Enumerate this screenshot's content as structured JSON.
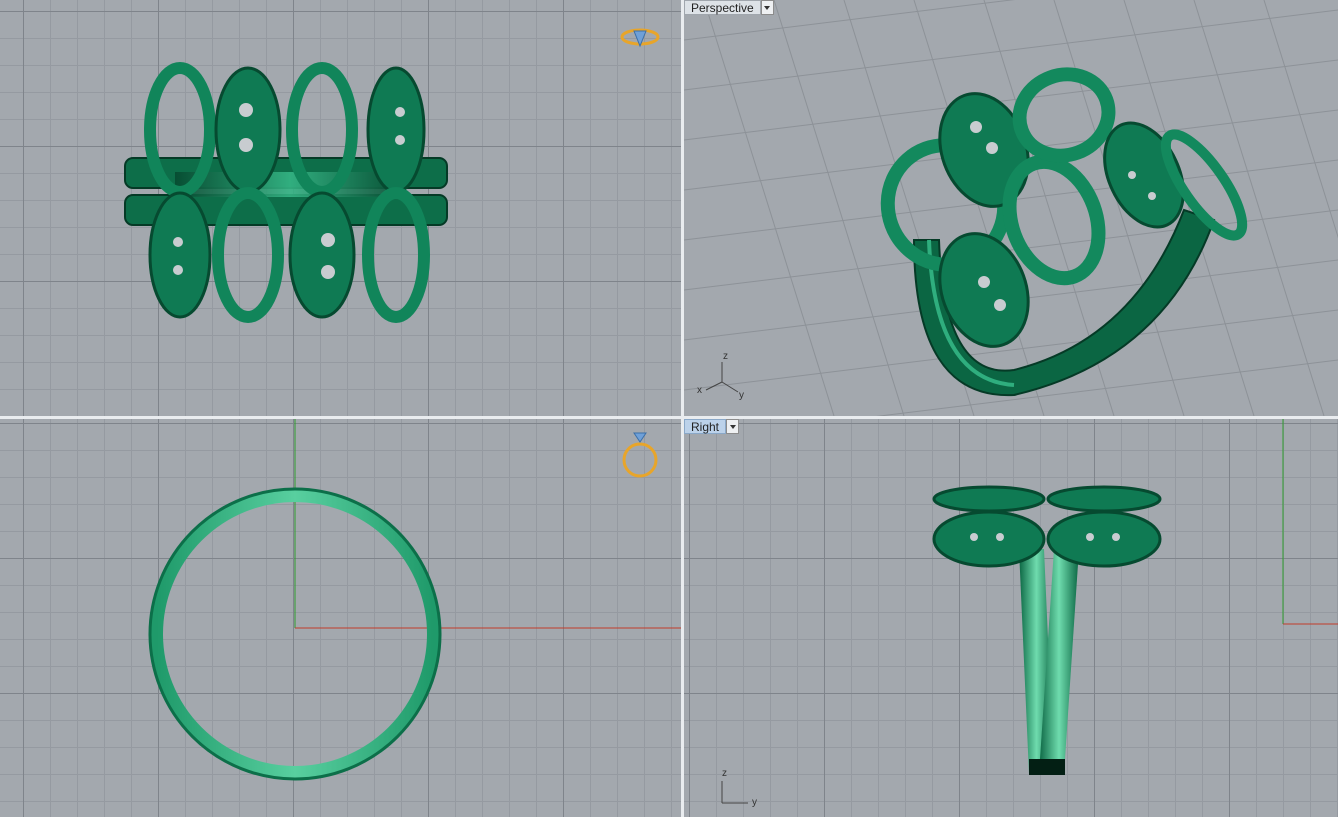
{
  "viewports": {
    "top": {
      "name": ""
    },
    "perspective": {
      "label": "Perspective"
    },
    "front": {
      "name": ""
    },
    "right": {
      "label": "Right"
    }
  },
  "axis_labels": {
    "perspective": {
      "z": "z",
      "x": "x",
      "y": "y"
    },
    "right": {
      "z": "z",
      "y": "y"
    }
  },
  "icons": {
    "top_gizmo": "ring-top-view-icon",
    "front_gizmo": "ring-front-view-icon",
    "dropdown": "chevron-down-icon"
  },
  "colors": {
    "model": "#0e7a52",
    "model_light": "#3fbf8c",
    "model_dark": "#064a30",
    "grid_bg": "#a3a8ae",
    "x_axis": "#c23b2b",
    "y_axis": "#2f9c2f",
    "gizmo": "#e8a52a",
    "label_active": "#bcd2ea"
  }
}
